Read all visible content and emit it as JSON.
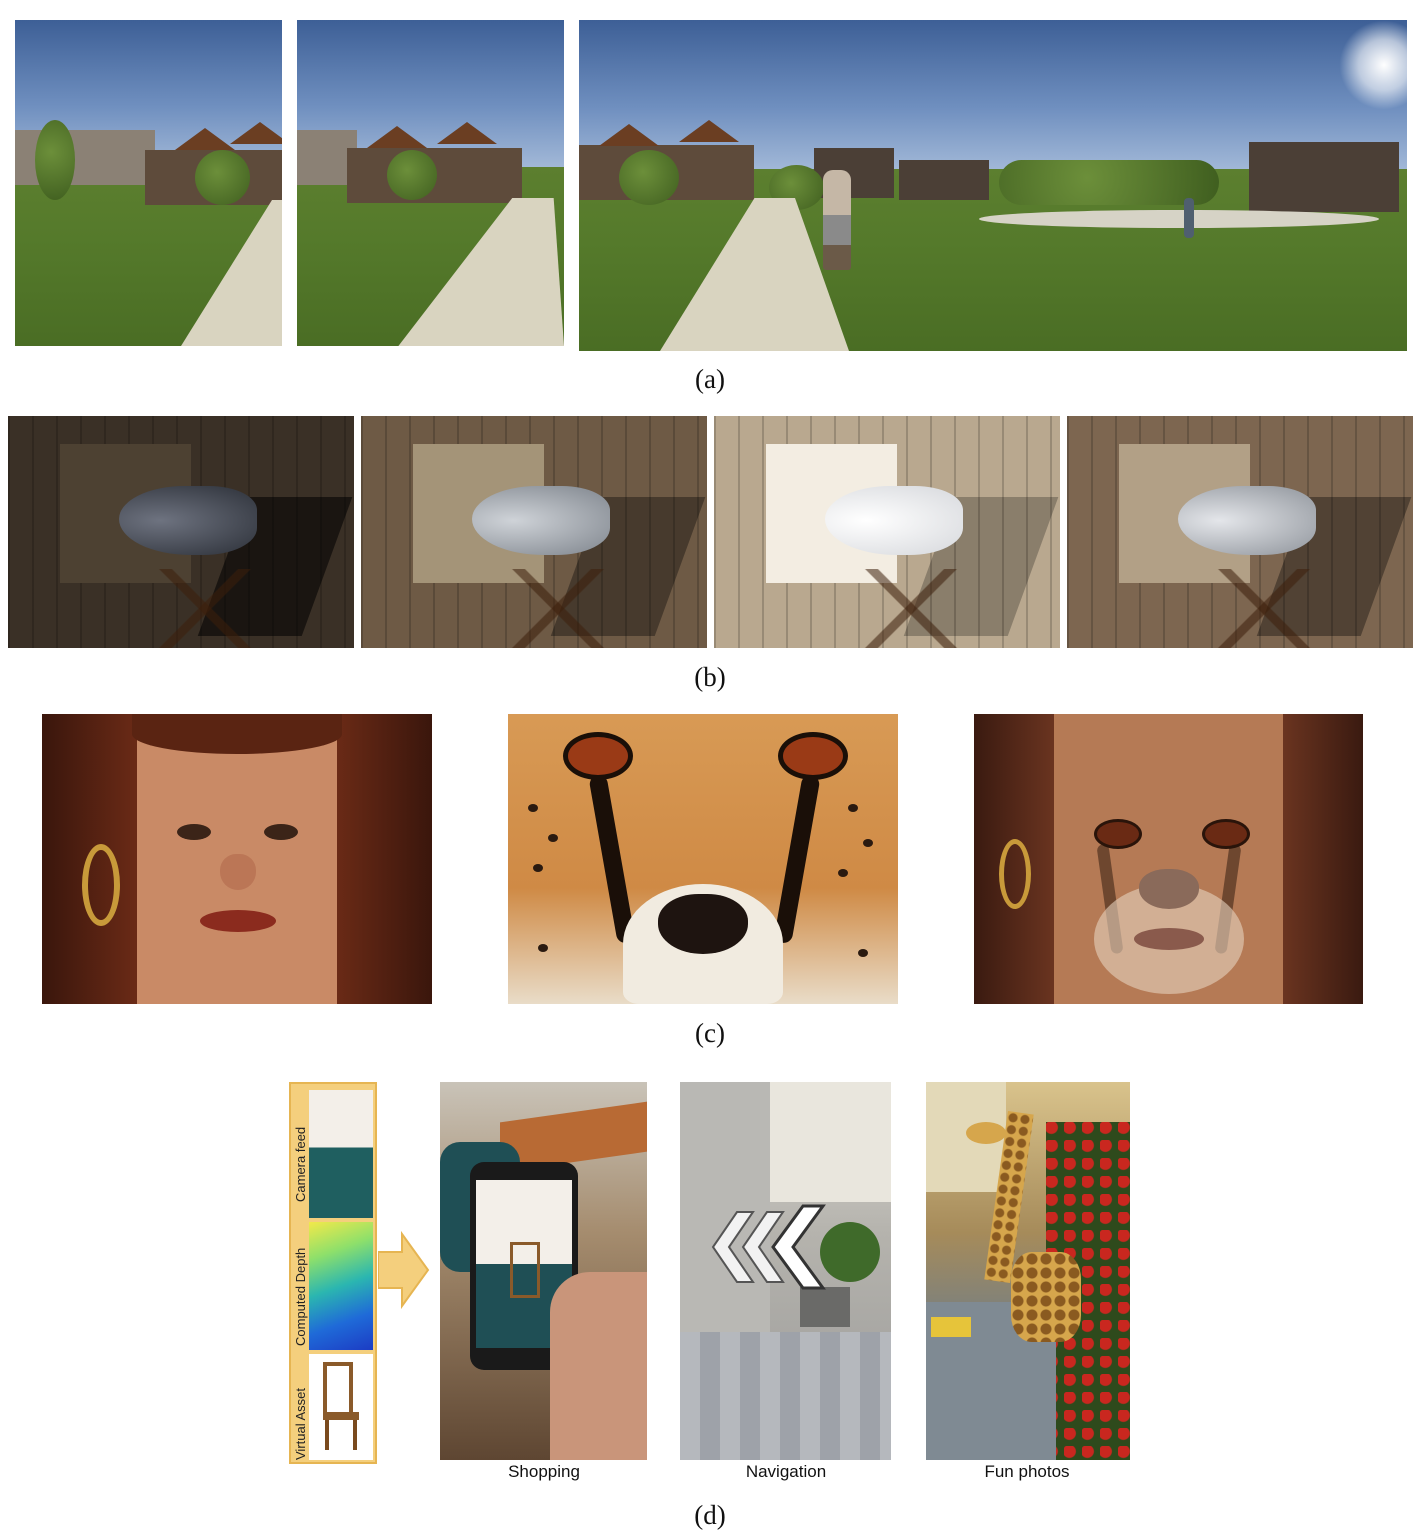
{
  "captions": {
    "a": "(a)",
    "b": "(b)",
    "c": "(c)",
    "d": "(d)"
  },
  "ar_panel": {
    "camera_feed": "Camera feed",
    "computed_depth": "Computed Depth",
    "virtual_asset": "Virtual Asset"
  },
  "ar_labels": {
    "shopping": "Shopping",
    "navigation": "Navigation",
    "fun_photos": "Fun photos"
  }
}
